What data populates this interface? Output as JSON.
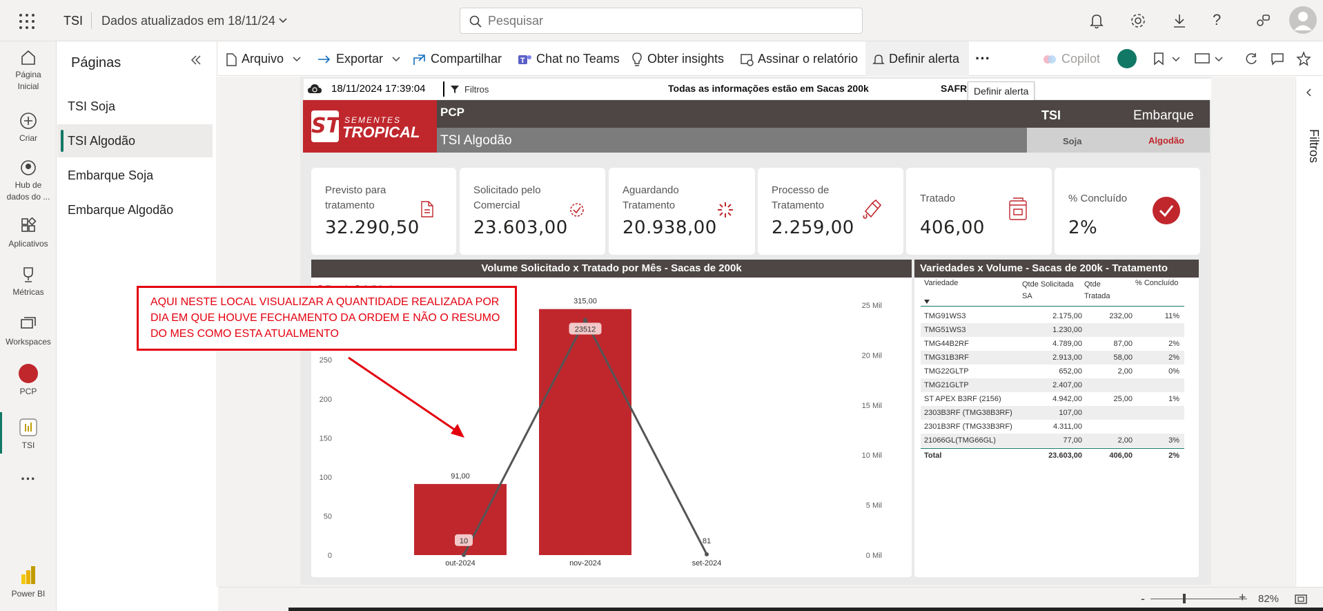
{
  "header": {
    "app": "TSI",
    "updated": "Dados atualizados em 18/11/24",
    "search_placeholder": "Pesquisar"
  },
  "leftnav": {
    "home": "Página Inicial",
    "create": "Criar",
    "hub": "Hub de dados do ...",
    "apps": "Aplicativos",
    "metrics": "Métricas",
    "workspaces": "Workspaces",
    "pcp": "PCP",
    "tsi": "TSI",
    "powerbi": "Power BI"
  },
  "pages": {
    "title": "Páginas",
    "items": [
      "TSI Soja",
      "TSI Algodão",
      "Embarque Soja",
      "Embarque Algodão"
    ],
    "active_index": 1
  },
  "toolbar": {
    "arquivo": "Arquivo",
    "exportar": "Exportar",
    "compartilhar": "Compartilhar",
    "teams": "Chat no Teams",
    "insights": "Obter insights",
    "assinar": "Assinar o relatório",
    "alerta": "Definir alerta",
    "copilot": "Copilot",
    "tooltip": "Definir alerta"
  },
  "report": {
    "timestamp": "18/11/2024 17:39:04",
    "filtros": "Filtros",
    "note": "Todas as informações estão em Sacas 200k",
    "safr": "SAFR",
    "logo_line1": "SEMENTES",
    "logo_line2": "TROPICAL",
    "logo_mark": "ST",
    "pcp": "PCP",
    "subtitle": "TSI Algodão",
    "tsi": "TSI",
    "embarque": "Embarque",
    "soja": "Soja",
    "algodao": "Algodão",
    "filters_panel": "Filtros"
  },
  "kpis": [
    {
      "label": "Previsto para tratamento",
      "value": "32.290,50",
      "icon": "document-icon"
    },
    {
      "label": "Solicitado pelo Comercial",
      "value": "23.603,00",
      "icon": "badge-check-icon"
    },
    {
      "label": "Aguardando Tratamento",
      "value": "20.938,00",
      "icon": "loading-icon"
    },
    {
      "label": "Processo de Tratamento",
      "value": "2.259,00",
      "icon": "paint-icon"
    },
    {
      "label": "Tratado",
      "value": "406,00",
      "icon": "box-icon"
    },
    {
      "label": "% Concluído",
      "value": "2%",
      "icon": "check-circle-icon"
    }
  ],
  "annotation": {
    "text": "AQUI NESTE LOCAL VISUALIZAR A QUANTIDADE REALIZADA POR DIA EM QUE HOUVE FECHAMENTO DA ORDEM E NÃO O RESUMO DO MES COMO ESTA ATUALMENTO"
  },
  "chart_data": {
    "type": "bar",
    "title": "Volume Solicitado x Tratado por Mês - Sacas de 200k",
    "legend": [
      "Tratado",
      "Solicitado"
    ],
    "categories": [
      "out-2024",
      "nov-2024",
      "set-2024"
    ],
    "series": [
      {
        "name": "Tratado",
        "type": "bar",
        "values": [
          91,
          315,
          0
        ],
        "labels": [
          "91,00",
          "315,00",
          ""
        ]
      },
      {
        "name": "Solicitado",
        "type": "line",
        "values": [
          10,
          23512,
          81
        ],
        "labels": [
          "10",
          "23512",
          "81"
        ]
      }
    ],
    "left_axis": {
      "ticks": [
        "0",
        "50",
        "100",
        "150",
        "200",
        "250"
      ],
      "ylim": [
        0,
        320
      ]
    },
    "right_axis": {
      "ticks": [
        "0 Mil",
        "5 Mil",
        "10 Mil",
        "15 Mil",
        "20 Mil",
        "25 Mil"
      ],
      "ylim": [
        0,
        25000
      ]
    },
    "colors": {
      "bar": "#c0272d",
      "line": "#555555"
    }
  },
  "table": {
    "title": "Variedades x Volume - Sacas de 200k - Tratamento",
    "headers": [
      "Variedade",
      "Qtde Solicitada SA",
      "Qtde Tratada",
      "% Concluído"
    ],
    "rows": [
      [
        "TMG91WS3",
        "2.175,00",
        "232,00",
        "11%"
      ],
      [
        "TMG51WS3",
        "1.230,00",
        "",
        ""
      ],
      [
        "TMG44B2RF",
        "4.789,00",
        "87,00",
        "2%"
      ],
      [
        "TMG31B3RF",
        "2.913,00",
        "58,00",
        "2%"
      ],
      [
        "TMG22GLTP",
        "652,00",
        "2,00",
        "0%"
      ],
      [
        "TMG21GLTP",
        "2.407,00",
        "",
        ""
      ],
      [
        "ST APEX B3RF (2156)",
        "4.942,00",
        "25,00",
        "1%"
      ],
      [
        "2303B3RF (TMG38B3RF)",
        "107,00",
        "",
        ""
      ],
      [
        "2301B3RF (TMG33B3RF)",
        "4.311,00",
        "",
        ""
      ],
      [
        "21066GL(TMG66GL)",
        "77,00",
        "2,00",
        "3%"
      ]
    ],
    "total": [
      "Total",
      "23.603,00",
      "406,00",
      "2%"
    ]
  },
  "footer": {
    "zoom": "82%"
  },
  "colors": {
    "brand_red": "#c0272d",
    "header_dark": "#4d4644",
    "accent_green": "#117865"
  }
}
